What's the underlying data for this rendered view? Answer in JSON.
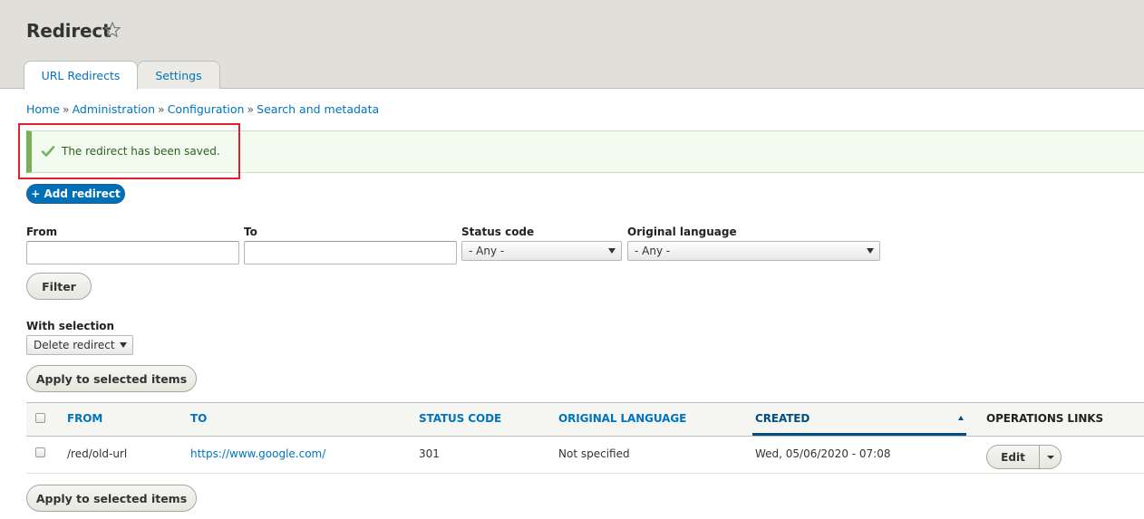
{
  "header": {
    "title": "Redirect",
    "tabs": [
      {
        "label": "URL Redirects",
        "active": true
      },
      {
        "label": "Settings",
        "active": false
      }
    ]
  },
  "breadcrumb": [
    "Home",
    "Administration",
    "Configuration",
    "Search and metadata"
  ],
  "message": {
    "text": "The redirect has been saved.",
    "icon": "check-icon",
    "status": "success"
  },
  "actions": {
    "add_redirect": "+ Add redirect"
  },
  "filters": {
    "from": {
      "label": "From",
      "value": ""
    },
    "to": {
      "label": "To",
      "value": ""
    },
    "status_code": {
      "label": "Status code",
      "selected": "- Any -"
    },
    "original_language": {
      "label": "Original language",
      "selected": "- Any -"
    },
    "filter_button": "Filter"
  },
  "bulk": {
    "label": "With selection",
    "selected": "Delete redirect",
    "apply_button": "Apply to selected items"
  },
  "table": {
    "columns": [
      "FROM",
      "TO",
      "STATUS CODE",
      "ORIGINAL LANGUAGE",
      "CREATED",
      "OPERATIONS LINKS"
    ],
    "sorted_column": "CREATED",
    "rows": [
      {
        "from": "/red/old-url",
        "to": "https://www.google.com/",
        "status_code": "301",
        "language": "Not specified",
        "created": "Wed, 05/06/2020 - 07:08",
        "operation": "Edit"
      }
    ]
  },
  "colors": {
    "link": "#0074bd",
    "primary_button": "#0071b8",
    "success_border": "#77b259",
    "highlight": "#e0202a"
  }
}
